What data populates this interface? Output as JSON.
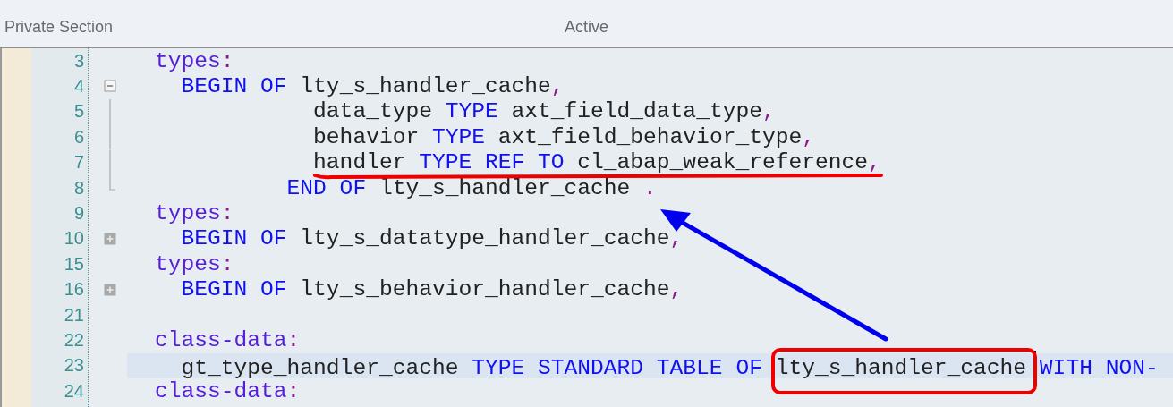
{
  "header": {
    "section": "Private Section",
    "status": "Active"
  },
  "lines": [
    {
      "number": "3",
      "current": false,
      "kind": "plain",
      "tokens": [
        {
          "kind": "declaration",
          "text": "types"
        },
        {
          "kind": "punct",
          "text": ":"
        }
      ]
    },
    {
      "number": "4",
      "current": false,
      "kind": "collapsible",
      "tokens": [
        {
          "kind": "keyword",
          "text": "  BEGIN OF"
        },
        {
          "kind": "plain",
          "text": " lty_s_handler_cache"
        },
        {
          "kind": "punct",
          "text": ","
        }
      ]
    },
    {
      "number": "5",
      "current": false,
      "kind": "inside",
      "tokens": [
        {
          "kind": "plain",
          "text": "            data_type "
        },
        {
          "kind": "keyword",
          "text": "TYPE"
        },
        {
          "kind": "plain",
          "text": " axt_field_data_type"
        },
        {
          "kind": "punct",
          "text": ","
        }
      ]
    },
    {
      "number": "6",
      "current": false,
      "kind": "inside",
      "tokens": [
        {
          "kind": "plain",
          "text": "            behavior "
        },
        {
          "kind": "keyword",
          "text": "TYPE"
        },
        {
          "kind": "plain",
          "text": " axt_field_behavior_type"
        },
        {
          "kind": "punct",
          "text": ","
        }
      ]
    },
    {
      "number": "7",
      "current": false,
      "kind": "inside",
      "tokens": [
        {
          "kind": "plain",
          "text": "            handler "
        },
        {
          "kind": "keyword",
          "text": "TYPE REF TO"
        },
        {
          "kind": "plain",
          "text": " cl_abap_weak_reference"
        },
        {
          "kind": "punct",
          "text": ","
        }
      ]
    },
    {
      "number": "8",
      "current": false,
      "kind": "blockend",
      "tokens": [
        {
          "kind": "keyword",
          "text": "          END OF"
        },
        {
          "kind": "plain",
          "text": " lty_s_handler_cache "
        },
        {
          "kind": "punct",
          "text": "."
        }
      ]
    },
    {
      "number": "9",
      "current": false,
      "kind": "plain",
      "tokens": [
        {
          "kind": "declaration",
          "text": "types"
        },
        {
          "kind": "punct",
          "text": ":"
        }
      ]
    },
    {
      "number": "10",
      "current": false,
      "kind": "folded",
      "tokens": [
        {
          "kind": "keyword",
          "text": "  BEGIN OF"
        },
        {
          "kind": "plain",
          "text": " lty_s_datatype_handler_cache"
        },
        {
          "kind": "punct",
          "text": ","
        }
      ]
    },
    {
      "number": "15",
      "current": false,
      "kind": "plain",
      "tokens": [
        {
          "kind": "declaration",
          "text": "types"
        },
        {
          "kind": "punct",
          "text": ":"
        }
      ]
    },
    {
      "number": "16",
      "current": false,
      "kind": "folded",
      "tokens": [
        {
          "kind": "keyword",
          "text": "  BEGIN OF"
        },
        {
          "kind": "plain",
          "text": " lty_s_behavior_handler_cache"
        },
        {
          "kind": "punct",
          "text": ","
        }
      ]
    },
    {
      "number": "21",
      "current": false,
      "kind": "plain"
    },
    {
      "number": "22",
      "current": false,
      "kind": "plain",
      "tokens": [
        {
          "kind": "declaration",
          "text": "class-data"
        },
        {
          "kind": "punct",
          "text": ":"
        }
      ]
    },
    {
      "number": "23",
      "current": true,
      "kind": "plain",
      "tokens": [
        {
          "kind": "plain",
          "text": "  gt_type_handler_cache "
        },
        {
          "kind": "keyword",
          "text": "TYPE STANDARD TABLE OF"
        },
        {
          "kind": "plain",
          "text": " lty_s_handler_cache "
        },
        {
          "kind": "cursor"
        },
        {
          "kind": "keyword",
          "text": "WITH NON-"
        }
      ]
    },
    {
      "number": "24",
      "current": false,
      "kind": "plain",
      "tokens": [
        {
          "kind": "declaration",
          "text": "class-data"
        },
        {
          "kind": "punct",
          "text": ":"
        }
      ]
    }
  ],
  "annotations": [
    {
      "kind": "underline",
      "color": "#ee0000"
    },
    {
      "kind": "frame",
      "color": "#ee0000"
    },
    {
      "kind": "arrow",
      "color": "#0000ee"
    }
  ]
}
